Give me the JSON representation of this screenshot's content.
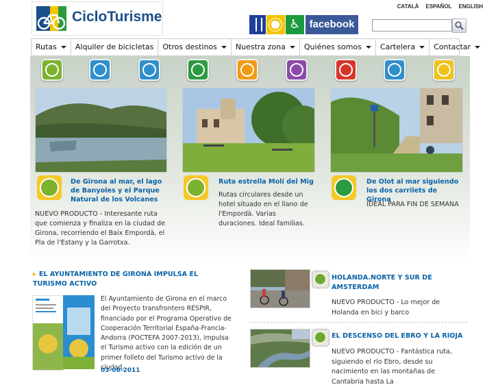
{
  "header": {
    "logo_text": "CicloTurisme",
    "languages": [
      "CATALÀ",
      "ESPAÑOL",
      "ENGLISH"
    ],
    "facebook_label": "facebook",
    "search_placeholder": ""
  },
  "nav": {
    "items": [
      {
        "label": "Rutas",
        "dropdown": true
      },
      {
        "label": "Alquiler de bicicletas",
        "dropdown": false
      },
      {
        "label": "Otros destinos",
        "dropdown": true
      },
      {
        "label": "Nuestra zona",
        "dropdown": true
      },
      {
        "label": "Quiénes somos",
        "dropdown": true
      },
      {
        "label": "Cartelera",
        "dropdown": true
      },
      {
        "label": "Contactar",
        "dropdown": true
      }
    ]
  },
  "category_icons": [
    {
      "name": "cycling-icon",
      "color": "#7bb32e"
    },
    {
      "name": "road-cycling-icon",
      "color": "#2f8fcd"
    },
    {
      "name": "mountain-route-icon",
      "color": "#2f8fcd"
    },
    {
      "name": "train-route-icon",
      "color": "#2c9a3f"
    },
    {
      "name": "hiking-icon",
      "color": "#f29a12"
    },
    {
      "name": "group-icon",
      "color": "#8c4aa8"
    },
    {
      "name": "family-icon",
      "color": "#d7352b"
    },
    {
      "name": "boat-icon",
      "color": "#2f8fcd"
    },
    {
      "name": "map-icon",
      "color": "#f0c21a"
    }
  ],
  "features": [
    {
      "title": "De Girona al mar, el lago de Banyoles y el Parque Natural de los Volcanes",
      "body": "NUEVO PRODUCTO - Interesante ruta que comienza y finaliza en la ciudad de Girona, recorriendo el Baix Empordà, el Pla de l'Estany y la Garrotxa.",
      "badge_icon": "cycling-icon"
    },
    {
      "title": "Ruta estrella Molí del Mig",
      "body": "Rutas circulares desde un hotel situado en el llano de l'Empordà. Varias duraciones. Ideal familias.",
      "badge_icon": "cycling-icon"
    },
    {
      "title": "De Olot al mar siguiendo los dos carrilets de Girona",
      "body": "IDEAL PARA FIN DE SEMANA",
      "badge_icon": "train-route-icon"
    }
  ],
  "news": {
    "title": "EL AYUNTAMIENTO DE GIRONA IMPULSA EL TURISMO ACTIVO",
    "body": "El Ayuntamiento de Girona en el marco del Proyecto transfrontero RESPIR, financiado por el Programa Operativo de Cooperación Territorial España-Francia- Andorra (POCTEFA 2007-2013), impulsa el Turismo activo con la edición de un primer folleto del Turismo activo de la ciudad.",
    "date": "03-06-2011"
  },
  "products": [
    {
      "title": "HOLANDA.NORTE Y SUR DE AMSTERDAM",
      "body": "NUEVO PRODUCTO - Lo mejor de Holanda en bici y barco"
    },
    {
      "title": "EL DESCENSO DEL EBRO Y LA RIOJA",
      "body": "NUEVO PRODUCTO - Fantástica ruta, siguiendo el río Ebro, desde su nacimiento en las montañas de Cantabria hasta La"
    }
  ]
}
